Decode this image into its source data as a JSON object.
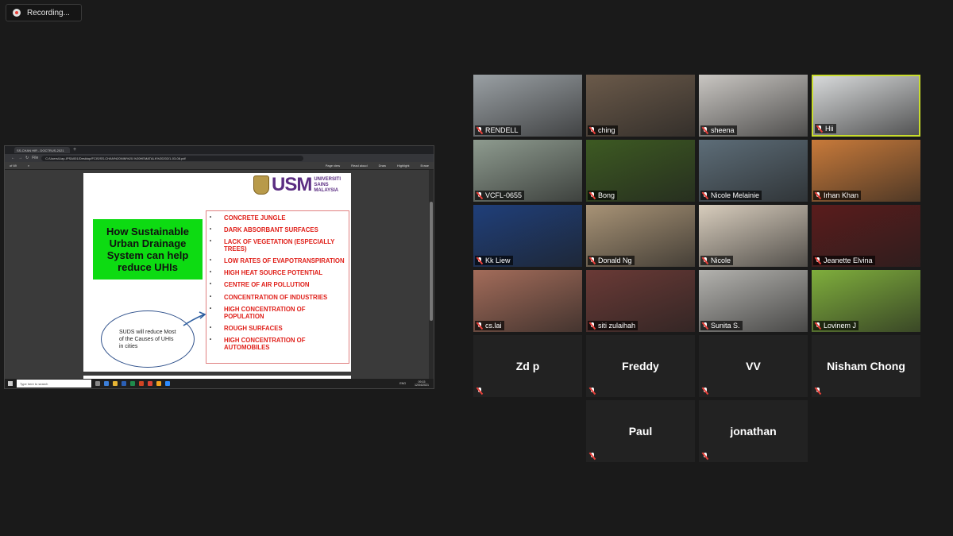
{
  "recording": {
    "label": "Recording..."
  },
  "browser": {
    "tab_title": "SS-CHAN HIR - DOCTRUS-2021",
    "url": "C:/Users/Liap-IPSA001/Desktop/FCIS/SS-CHAN%20NIM%20-%20HEMATALK%20202/1-03-08.pdf",
    "file_label": "File",
    "page_box": "of 69",
    "toolbar": [
      "Page view",
      "Read aloud",
      "Draw",
      "Highlight",
      "Erase"
    ]
  },
  "slide": {
    "logo_text": "USM",
    "logo_sub": "UNIVERSITI SAINS MALAYSIA",
    "green_title": "How Sustainable Urban Drainage System  can help reduce UHIs",
    "causes": [
      "CONCRETE JUNGLE",
      "DARK ABSORBANT SURFACES",
      "LACK OF VEGETATION (ESPECIALLY TREES)",
      "LOW RATES OF EVAPOTRANSPIRATION",
      "HIGH HEAT SOURCE POTENTIAL",
      "CENTRE OF AIR POLLUTION",
      "CONCENTRATION OF INDUSTRIES",
      "HIGH CONCENTRATION OF POPULATION",
      "ROUGH SURFACES",
      "HIGH CONCENTRATION OF AUTOMOBILES"
    ],
    "bullet": "•",
    "ellipse_text": "SUDS will reduce Most of the Causes of UHIs in cities"
  },
  "taskbar": {
    "search_placeholder": "Type here to search",
    "time": "09:15",
    "date": "12/04/2021",
    "lang": "ENG"
  },
  "participants": [
    {
      "name": "RENDELL",
      "video": true,
      "color": "#9aa0a4"
    },
    {
      "name": "ching",
      "video": true,
      "color": "#6b5a4a"
    },
    {
      "name": "sheena",
      "video": true,
      "color": "#c9c6c2"
    },
    {
      "name": "Hii",
      "video": true,
      "color": "#d7d9da",
      "speaking": true
    },
    {
      "name": "VCFL-0655",
      "video": true,
      "color": "#8e9b8f"
    },
    {
      "name": "Bong",
      "video": true,
      "color": "#3d5a22"
    },
    {
      "name": "Nicole Melainie",
      "video": true,
      "color": "#5d6d78"
    },
    {
      "name": "Irhan Khan",
      "video": true,
      "color": "#c87a3a"
    },
    {
      "name": "Kk Liew",
      "video": true,
      "color": "#1f3f7a"
    },
    {
      "name": "Donald Ng",
      "video": true,
      "color": "#a89376"
    },
    {
      "name": "Nicole",
      "video": true,
      "color": "#d8cdbd"
    },
    {
      "name": "Jeanette Elvina",
      "video": true,
      "color": "#5a1c1c"
    },
    {
      "name": "cs.lai",
      "video": true,
      "color": "#a36c5a"
    },
    {
      "name": "siti zulaihah",
      "video": true,
      "color": "#6a3a36"
    },
    {
      "name": "Sunita S.",
      "video": true,
      "color": "#b3b2ae"
    },
    {
      "name": "Lovinem J",
      "video": true,
      "color": "#7fae3c"
    },
    {
      "name": "Zd p",
      "video": false
    },
    {
      "name": "Freddy",
      "video": false
    },
    {
      "name": "VV",
      "video": false
    },
    {
      "name": "Nisham Chong",
      "video": false
    },
    {
      "name": "Paul",
      "video": false
    },
    {
      "name": "jonathan",
      "video": false
    }
  ]
}
